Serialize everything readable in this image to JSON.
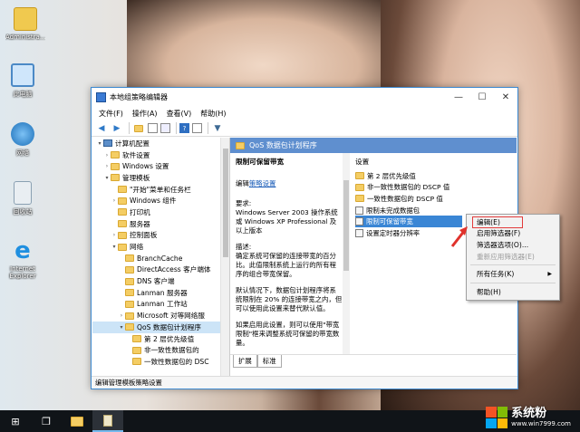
{
  "desktop": {
    "icons": [
      {
        "label": "Administra..."
      },
      {
        "label": "此电脑"
      },
      {
        "label": "网络"
      },
      {
        "label": "回收站"
      },
      {
        "label": "Internet Explorer"
      }
    ]
  },
  "window": {
    "title": "本地组策略编辑器",
    "menu": [
      "文件(F)",
      "操作(A)",
      "查看(V)",
      "帮助(H)"
    ],
    "tree": [
      {
        "label": "计算机配置",
        "indent": 1,
        "toggle": "▾",
        "icon": "pc"
      },
      {
        "label": "软件设置",
        "indent": 2,
        "toggle": "›"
      },
      {
        "label": "Windows 设置",
        "indent": 2,
        "toggle": "›"
      },
      {
        "label": "管理模板",
        "indent": 2,
        "toggle": "▾"
      },
      {
        "label": "\"开始\"菜单和任务栏",
        "indent": 3,
        "toggle": ""
      },
      {
        "label": "Windows 组件",
        "indent": 3,
        "toggle": "›"
      },
      {
        "label": "打印机",
        "indent": 3,
        "toggle": ""
      },
      {
        "label": "服务器",
        "indent": 3,
        "toggle": ""
      },
      {
        "label": "控制面板",
        "indent": 3,
        "toggle": "›"
      },
      {
        "label": "网络",
        "indent": 3,
        "toggle": "▾"
      },
      {
        "label": "BranchCache",
        "indent": 4,
        "toggle": ""
      },
      {
        "label": "DirectAccess 客户端体",
        "indent": 4,
        "toggle": ""
      },
      {
        "label": "DNS 客户端",
        "indent": 4,
        "toggle": ""
      },
      {
        "label": "Lanman 服务器",
        "indent": 4,
        "toggle": ""
      },
      {
        "label": "Lanman 工作站",
        "indent": 4,
        "toggle": ""
      },
      {
        "label": "Microsoft 对等网络服",
        "indent": 4,
        "toggle": "›"
      },
      {
        "label": "QoS 数据包计划程序",
        "indent": 4,
        "toggle": "▾",
        "selected": true
      },
      {
        "label": "第 2 层优先级值",
        "indent": 5,
        "toggle": ""
      },
      {
        "label": "非一致性数据包的",
        "indent": 5,
        "toggle": ""
      },
      {
        "label": "一致性数据包的 DSC",
        "indent": 5,
        "toggle": ""
      }
    ],
    "content_header": "QoS 数据包计划程序",
    "description": {
      "policy_title": "限制可保留带宽",
      "edit_prefix": "编辑",
      "edit_link": "策略设置",
      "requirements": "要求:\nWindows Server 2003 操作系统或 Windows XP Professional 及以上版本",
      "desc1": "描述:\n确定系统可保留的连接带宽的百分比。此值限制系统上运行的所有程序的组合带宽保留。",
      "desc2": "默认情况下，数据包计划程序将系统限制在 20% 的连接带宽之内，但可以使用此设置来替代默认值。",
      "desc3": "如果启用此设置，则可以使用\"带宽限制\"框来调整系统可保留的带宽数量。"
    },
    "list": {
      "column": "设置",
      "items": [
        {
          "label": "第 2 层优先级值",
          "kind": "folder"
        },
        {
          "label": "非一致性数据包的 DSCP 值",
          "kind": "folder"
        },
        {
          "label": "一致性数据包的 DSCP 值",
          "kind": "folder"
        },
        {
          "label": "限制未完成数据包",
          "kind": "policy"
        },
        {
          "label": "限制可保留带宽",
          "kind": "policy",
          "selected": true
        },
        {
          "label": "设置定时器分辨率",
          "kind": "policy"
        }
      ]
    },
    "tabs": [
      "扩展",
      "标准"
    ],
    "status": "编辑管理模板策略设置"
  },
  "context_menu": {
    "items": [
      {
        "label": "编辑(E)",
        "highlighted": true
      },
      {
        "label": "启用筛选器(F)"
      },
      {
        "label": "筛选器选项(O)..."
      },
      {
        "label": "重新应用筛选器(E)",
        "disabled": true
      },
      {
        "sep": true
      },
      {
        "label": "所有任务(K)",
        "submenu": true
      },
      {
        "sep": true
      },
      {
        "label": "帮助(H)"
      }
    ]
  },
  "brand": {
    "text": "系统粉",
    "url": "www.win7999.com"
  }
}
